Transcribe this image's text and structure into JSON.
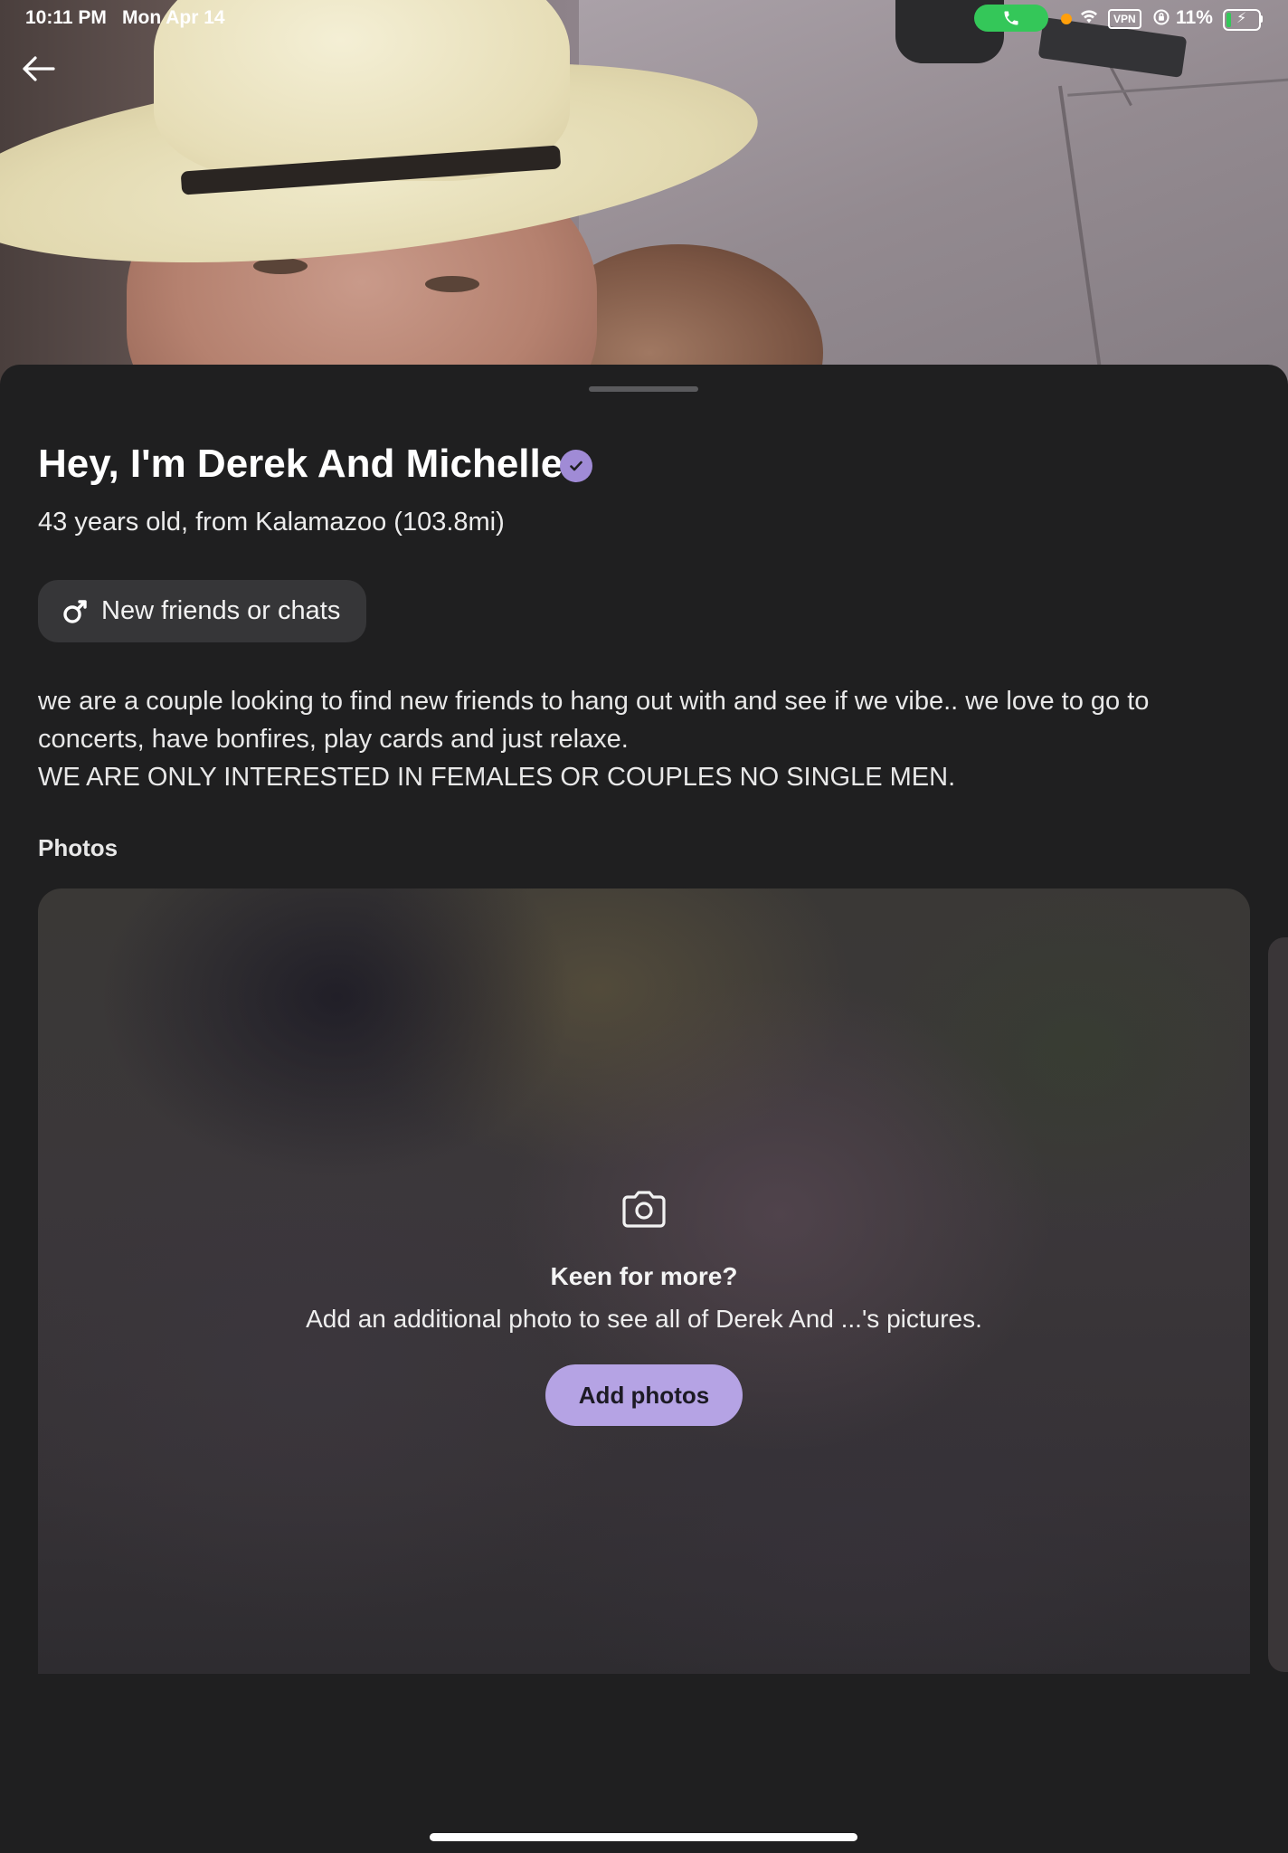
{
  "status_bar": {
    "time": "10:11 PM",
    "date": "Mon Apr 14",
    "vpn": "VPN",
    "battery": "11%"
  },
  "profile": {
    "title": "Hey, I'm Derek And Michelle",
    "subtitle": "43 years old, from Kalamazoo (103.8mi)",
    "intent": "New friends or chats",
    "bio_lines": [
      "we are a couple looking to find new friends to hang out with and see if we vibe.. we love to go to concerts, have bonfires, play cards and just relaxe.",
      "WE ARE ONLY INTERESTED IN FEMALES OR COUPLES NO SINGLE MEN."
    ]
  },
  "photos": {
    "label": "Photos",
    "locked_title": "Keen for more?",
    "locked_subtitle": "Add an additional photo to see all of Derek And ...'s pictures.",
    "add_button": "Add photos"
  },
  "icons": {
    "back": "back-arrow-icon",
    "verified": "verified-check-icon",
    "intent": "gender-symbol-icon",
    "camera": "camera-icon"
  },
  "colors": {
    "background": "#1f1f20",
    "accent": "#b5a3e4",
    "verified_badge": "#a08bd6",
    "chip": "#363638",
    "call_pill": "#34c759"
  }
}
